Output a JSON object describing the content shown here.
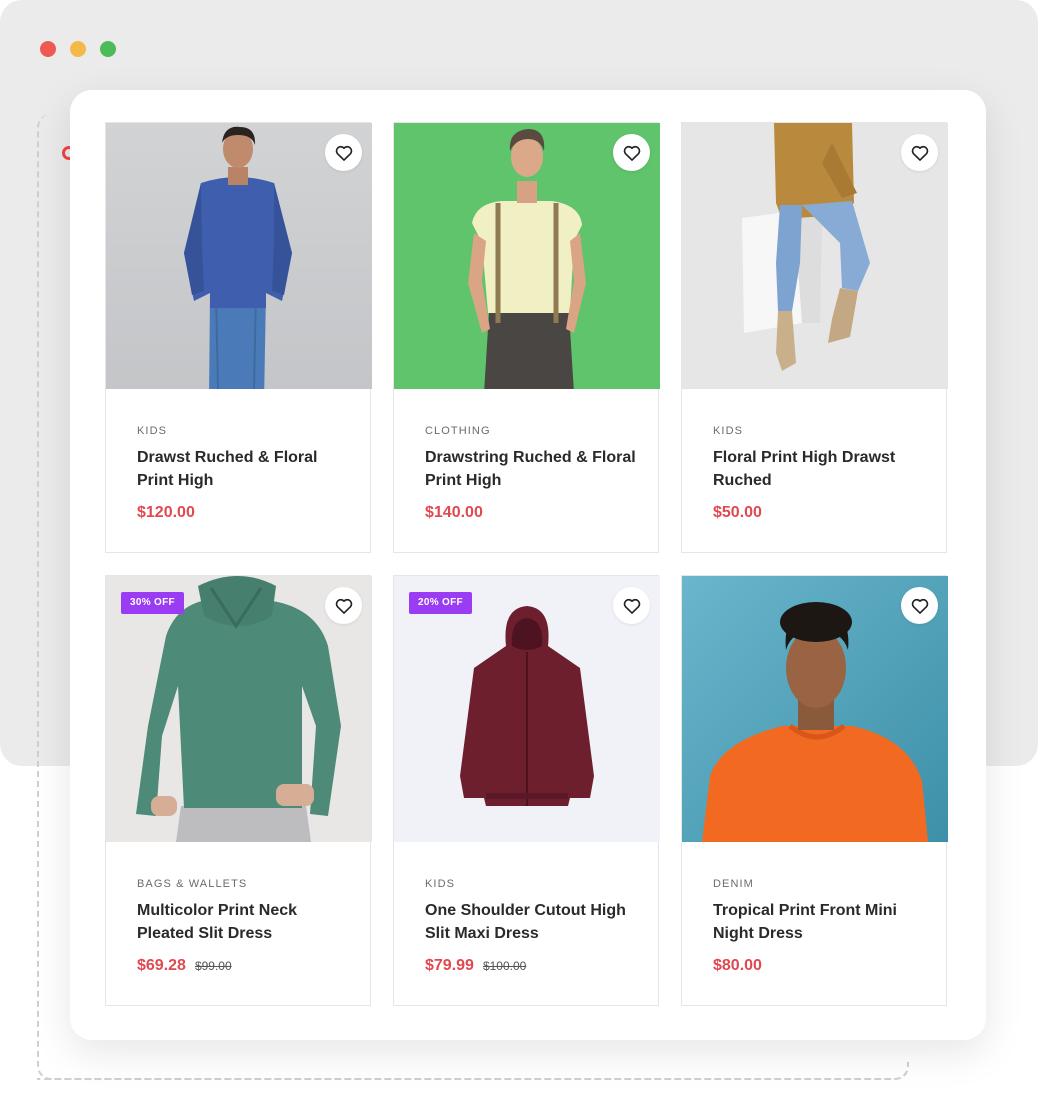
{
  "window": {
    "controls": [
      "close",
      "minimize",
      "maximize"
    ],
    "colors": {
      "close": "#ee5a52",
      "minimize": "#f5b84a",
      "maximize": "#4cbb5a"
    }
  },
  "accent_color": "#e0494f",
  "badge_color": "#9b3cf5",
  "products": [
    {
      "category": "KIDS",
      "title": "Drawst Ruched & Floral Print High",
      "price": "$120.00",
      "old_price": "",
      "badge": "",
      "image": "man-blue-sweater-jeans",
      "wishlist_icon": "heart-icon"
    },
    {
      "category": "CLOTHING",
      "title": "Drawstring Ruched & Floral Print High",
      "price": "$140.00",
      "old_price": "",
      "badge": "",
      "image": "man-suspenders-green-background",
      "wishlist_icon": "heart-icon"
    },
    {
      "category": "KIDS",
      "title": "Floral Print High Drawst Ruched",
      "price": "$50.00",
      "old_price": "",
      "badge": "",
      "image": "person-mustard-sweater-sitting",
      "wishlist_icon": "heart-icon"
    },
    {
      "category": "BAGS & WALLETS",
      "title": "Multicolor Print Neck Pleated Slit Dress",
      "price": "$69.28",
      "old_price": "$99.00",
      "badge": "30% OFF",
      "image": "man-green-hoodie",
      "wishlist_icon": "heart-icon"
    },
    {
      "category": "KIDS",
      "title": "One Shoulder Cutout High Slit Maxi Dress",
      "price": "$79.99",
      "old_price": "$100.00",
      "badge": "20% OFF",
      "image": "maroon-hoodie",
      "wishlist_icon": "heart-icon"
    },
    {
      "category": "DENIM",
      "title": "Tropical Print Front Mini Night Dress",
      "price": "$80.00",
      "old_price": "",
      "badge": "",
      "image": "man-orange-sweatshirt-blue-background",
      "wishlist_icon": "heart-icon"
    }
  ]
}
